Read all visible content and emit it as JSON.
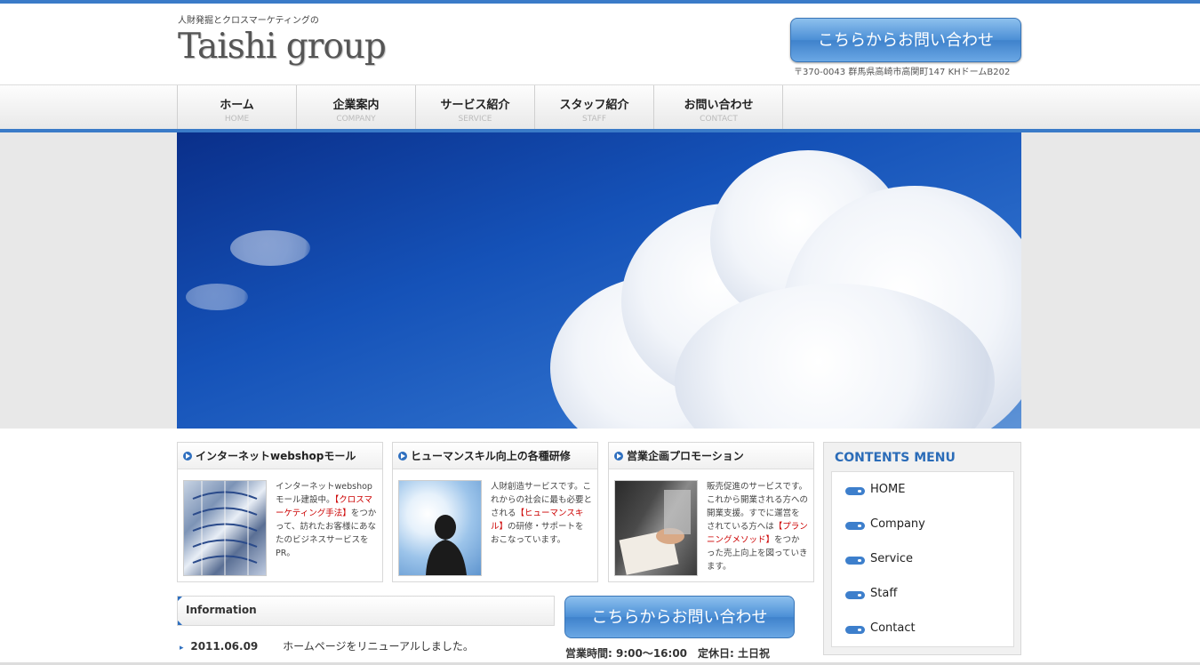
{
  "header": {
    "tagline": "人財発掘とクロスマーケティングの",
    "logo": "Taishi group",
    "contact_button": "こちらからお問い合わせ",
    "address": "〒370-0043 群馬県高崎市高関町147 KHドームB202"
  },
  "nav": [
    {
      "jp": "ホーム",
      "en": "HOME"
    },
    {
      "jp": "企業案内",
      "en": "COMPANY"
    },
    {
      "jp": "サービス紹介",
      "en": "SERVICE"
    },
    {
      "jp": "スタッフ紹介",
      "en": "STAFF"
    },
    {
      "jp": "お問い合わせ",
      "en": "CONTACT"
    }
  ],
  "cards": [
    {
      "title": "インターネットwebshopモール",
      "text1": "インターネットwebshopモール建設中。",
      "highlight": "【クロスマーケティング手法】",
      "text2": "をつかって、訪れたお客様にあなたのビジネスサービスをPR。"
    },
    {
      "title": "ヒューマンスキル向上の各種研修",
      "text1": "人財創造サービスです。これからの社会に最も必要とされる",
      "highlight": "【ヒューマンスキル】",
      "text2": "の研修・サポートをおこなっています。"
    },
    {
      "title": "営業企画プロモーション",
      "text1": "販売促進のサービスです。これから開業される方への開業支援。すでに運営をされている方へは",
      "highlight": "【プランニングメソッド】",
      "text2": "をつかった売上向上を図っていきます。"
    }
  ],
  "menu": {
    "title": "CONTENTS MENU",
    "items": [
      "HOME",
      "Company",
      "Service",
      "Staff",
      "Contact"
    ]
  },
  "info": {
    "title": "Information",
    "date": "2011.06.09",
    "text": "ホームページをリニューアルしました。"
  },
  "contact2": {
    "button": "こちらからお問い合わせ",
    "hours": "営業時間: 9:00〜16:00　定休日: 土日祝"
  },
  "colors": {
    "accent": "#3a7bc8",
    "highlight": "#cc0000"
  }
}
